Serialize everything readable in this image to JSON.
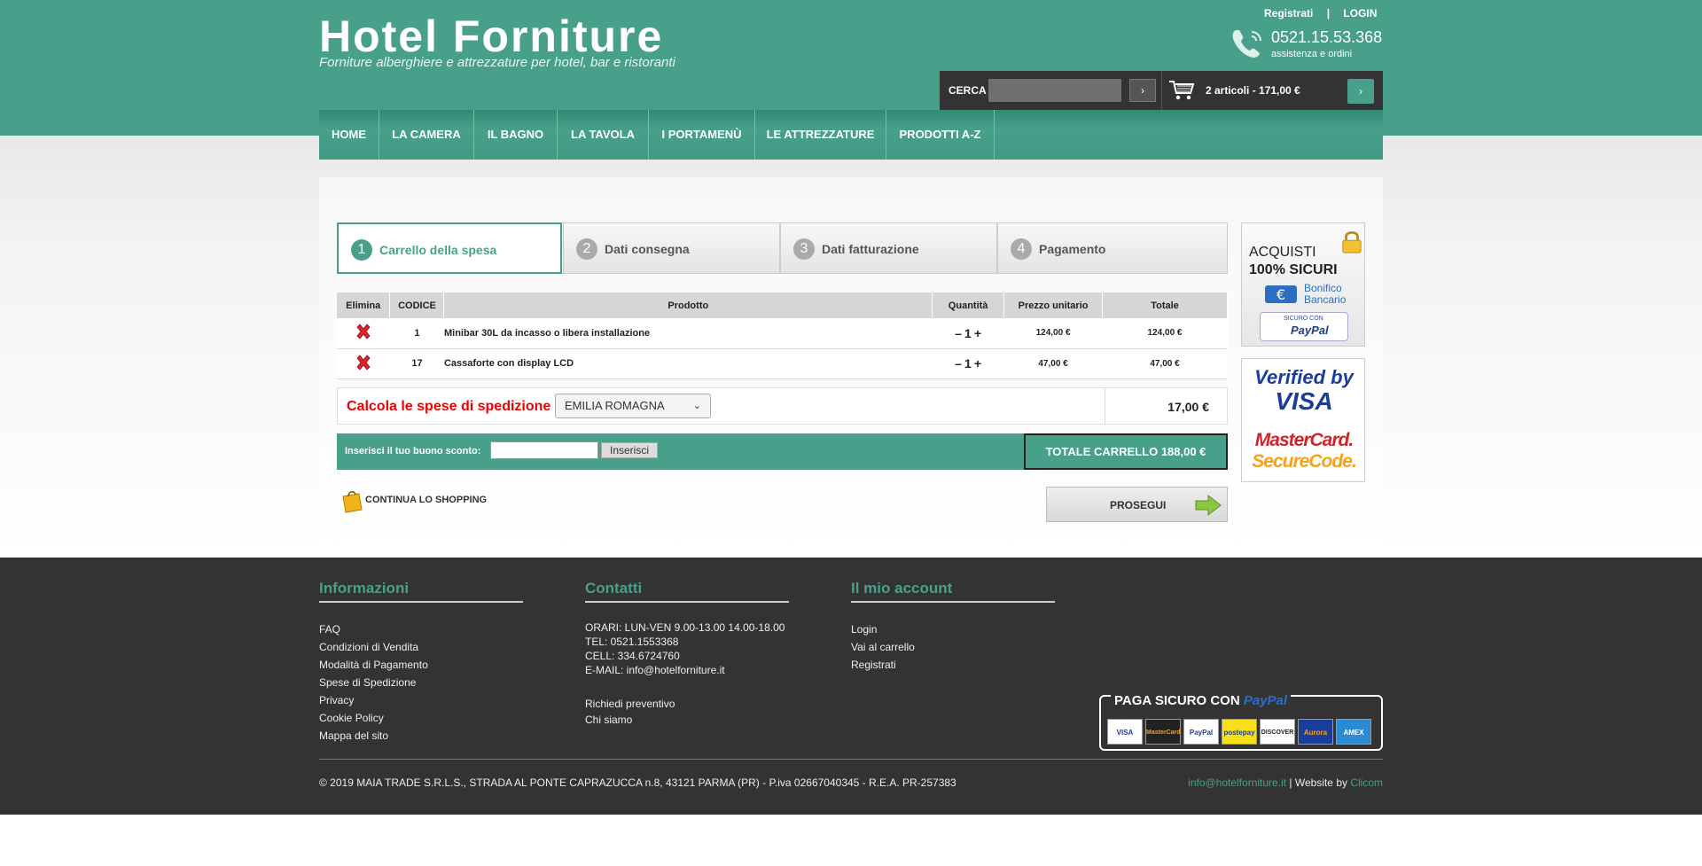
{
  "header": {
    "logo": "Hotel Forniture",
    "tagline": "Forniture alberghiere e attrezzature per hotel, bar e ristoranti",
    "register": "Registrati",
    "separator": "|",
    "login": "LOGIN",
    "phone": "0521.15.53.368",
    "phone_sub": "assistenza e ordini",
    "search_label": "CERCA",
    "search_placeholder": "CERCA",
    "search_btn": "›",
    "cart_summary": "2 articoli - 171,00 €",
    "cart_btn": "›"
  },
  "nav": [
    "HOME",
    "LA CAMERA",
    "IL BAGNO",
    "LA TAVOLA",
    "I PORTAMENÙ",
    "LE ATTREZZATURE",
    "PRODOTTI A-Z"
  ],
  "steps": [
    {
      "num": "1",
      "label": "Carrello della spesa"
    },
    {
      "num": "2",
      "label": "Dati consegna"
    },
    {
      "num": "3",
      "label": "Dati fatturazione"
    },
    {
      "num": "4",
      "label": "Pagamento"
    }
  ],
  "table": {
    "headers": [
      "Elimina",
      "CODICE",
      "Prodotto",
      "Quantità",
      "Prezzo unitario",
      "Totale"
    ],
    "rows": [
      {
        "code": "1",
        "product": "Minibar 30L da incasso o libera installazione",
        "qty": "1",
        "price": "124,00 €",
        "total": "124,00 €"
      },
      {
        "code": "17",
        "product": "Cassaforte con display LCD",
        "qty": "1",
        "price": "47,00 €",
        "total": "47,00 €"
      }
    ],
    "minus": "–",
    "plus": "+"
  },
  "shipping": {
    "label": "Calcola le spese di spedizione",
    "region": "EMILIA ROMAGNA",
    "chevron": "⌄",
    "cost": "17,00 €"
  },
  "coupon": {
    "label": "Inserisci il tuo buono sconto:",
    "button": "Inserisci",
    "total": "TOTALE CARRELLO 188,00 €"
  },
  "continue_label": "CONTINUA LO SHOPPING",
  "proceed_label": "PROSEGUI",
  "badges": {
    "b1_line1": "ACQUISTI",
    "b1_line2": "100% SICURI",
    "b1_bank1": "Bonifico",
    "b1_bank2": "Bancario",
    "b1_paypal_small": "SICURO CON",
    "b1_paypal": "PayPal",
    "verified1": "Verified by",
    "verified2": "VISA",
    "mastercard1": "MasterCard.",
    "mastercard2": "SecureCode."
  },
  "footer": {
    "col1_title": "Informazioni",
    "col1_items": [
      "FAQ",
      "Condizioni di Vendita",
      "Modalità di Pagamento",
      "Spese di Spedizione",
      "Privacy",
      "Cookie Policy",
      "Mappa del sito"
    ],
    "col2_title": "Contatti",
    "col2_lines": [
      "ORARI: LUN-VEN 9.00-13.00 14.00-18.00",
      "TEL: 0521.1553368",
      "CELL: 334.6724760",
      "E-MAIL: info@hotelforniture.it"
    ],
    "col2_links": [
      "Richiedi preventivo",
      "Chi siamo"
    ],
    "col3_title": "Il mio account",
    "col3_items": [
      "Login",
      "Vai al carrello",
      "Registrati"
    ],
    "paypal_title": "PAGA SICURO CON",
    "paypal_brand": "PayPal",
    "cards": [
      "VISA",
      "MasterCard",
      "PayPal",
      "postepay",
      "DISCOVER",
      "Aurora",
      "AMEX"
    ],
    "copyright": "© 2019 MAIA TRADE S.R.L.S., STRADA AL PONTE CAPRAZUCCA n.8, 43121 PARMA (PR) - P.iva 02667040345 - R.E.A. PR-257383",
    "credit_email": "info@hotelforniture.it",
    "credit_mid": " | Website by ",
    "credit_brand": "Clicom"
  },
  "colors": {
    "brand": "#48a08a",
    "dark": "#333333",
    "alert": "#e00000"
  }
}
